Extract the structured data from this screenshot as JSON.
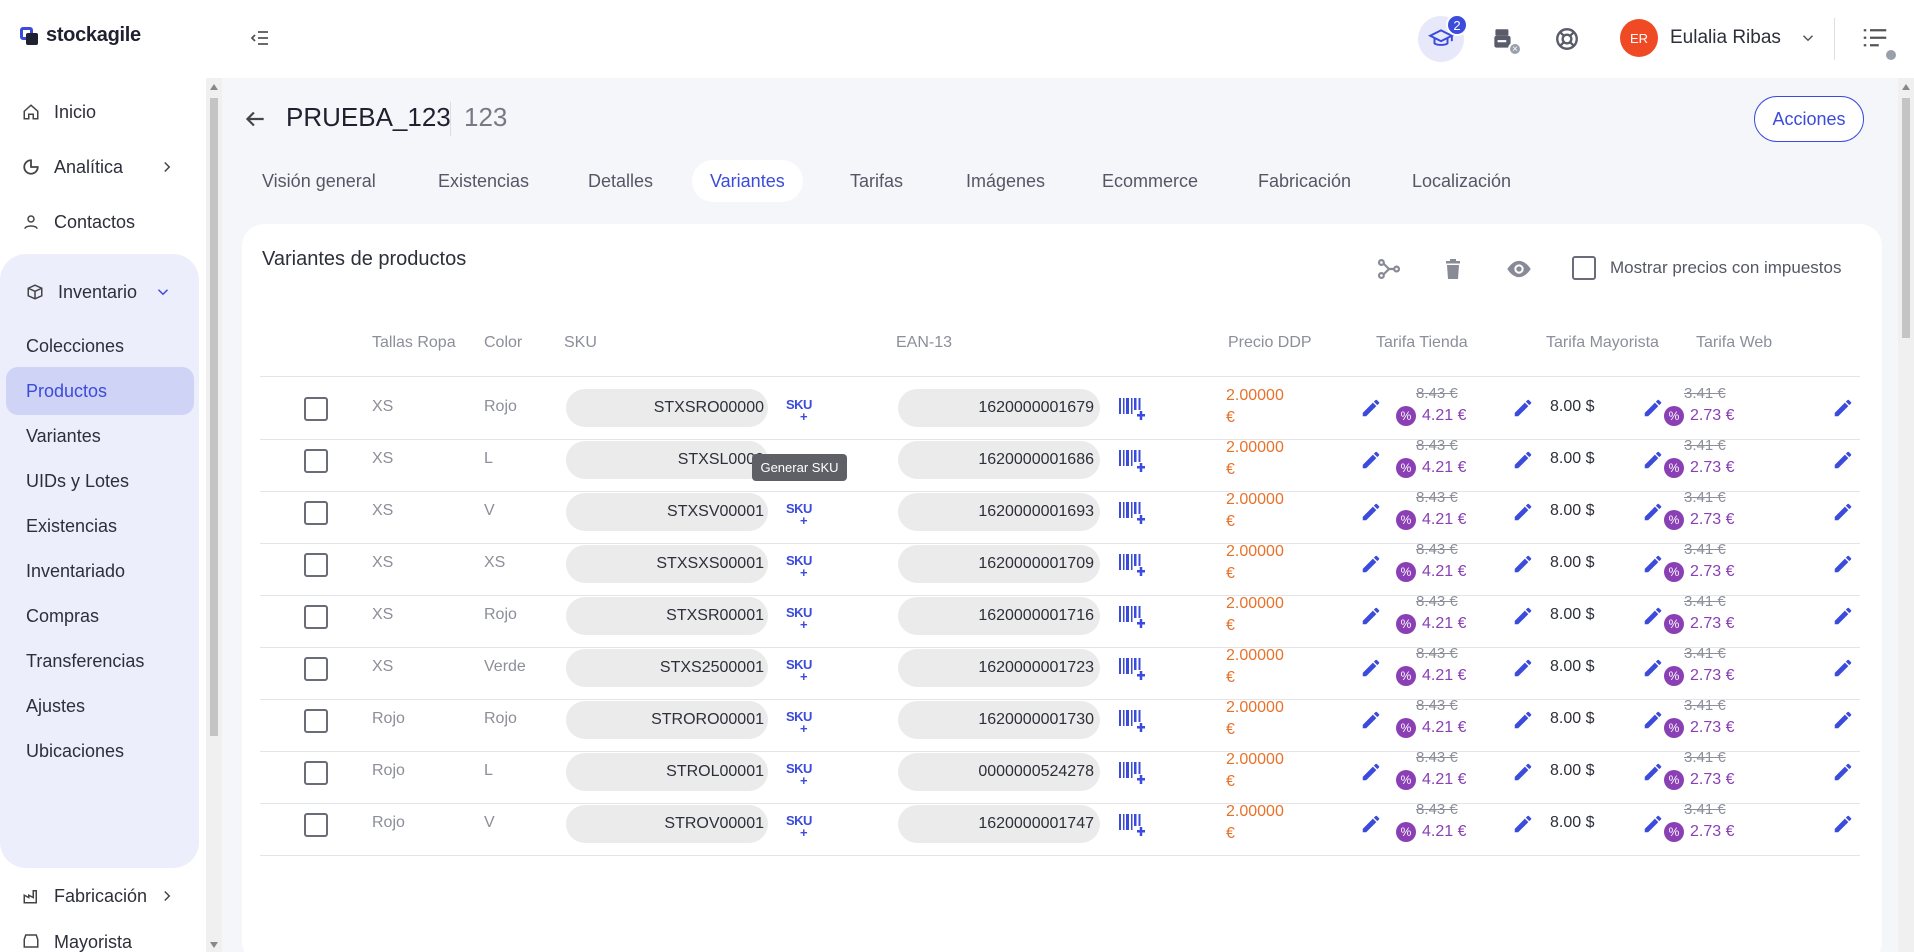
{
  "app": {
    "brand": "stockagile",
    "notifications_count": "2",
    "user_initials": "ER",
    "user_name": "Eulalia Ribas",
    "printer_status": "×"
  },
  "colors": {
    "accent": "#3b4bdb",
    "price": "#e8722a",
    "discount": "#8a3fb5",
    "avatar": "#ef4a23"
  },
  "sidebar": {
    "items": [
      {
        "label": "Inicio",
        "icon": "home-icon"
      },
      {
        "label": "Analítica",
        "icon": "analytics-icon"
      },
      {
        "label": "Contactos",
        "icon": "user-icon"
      },
      {
        "label": "Inventario",
        "icon": "box-icon"
      }
    ],
    "inventory_sub": [
      "Colecciones",
      "Productos",
      "Variantes",
      "UIDs y Lotes",
      "Existencias",
      "Inventariado",
      "Compras",
      "Transferencias",
      "Ajustes",
      "Ubicaciones"
    ],
    "active_sub": "Productos",
    "bottom_items": [
      {
        "label": "Fabricación",
        "icon": "factory-icon"
      },
      {
        "label": "Mayorista",
        "icon": "store-icon"
      }
    ]
  },
  "header": {
    "title": "PRUEBA_123",
    "code": "123",
    "actions_label": "Acciones"
  },
  "tabs": [
    "Visión general",
    "Existencias",
    "Detalles",
    "Variantes",
    "Tarifas",
    "Imágenes",
    "Ecommerce",
    "Fabricación",
    "Localización"
  ],
  "active_tab": "Variantes",
  "variants": {
    "title": "Variantes de productos",
    "tax_toggle_label": "Mostrar precios con impuestos",
    "columns": [
      "Tallas Ropa",
      "Color",
      "SKU",
      "EAN-13",
      "Precio DDP",
      "Tarifa Tienda",
      "Tarifa Mayorista",
      "Tarifa Web"
    ],
    "sku_generate_label": "SKU",
    "tooltip": "Generar SKU",
    "rows": [
      {
        "talla": "XS",
        "color": "Rojo",
        "sku": "STXSRO00000",
        "ean": "1620000001679",
        "price_a": "2.00000",
        "price_b": "€",
        "tienda_old": "8.43 €",
        "tienda_new": "4.21 €",
        "mayorista": "8.00 $",
        "web_old": "3.41 €",
        "web_new": "2.73 €"
      },
      {
        "talla": "XS",
        "color": "L",
        "sku": "STXSL0000",
        "ean": "1620000001686",
        "price_a": "2.00000",
        "price_b": "€",
        "tienda_old": "8.43 €",
        "tienda_new": "4.21 €",
        "mayorista": "8.00 $",
        "web_old": "3.41 €",
        "web_new": "2.73 €"
      },
      {
        "talla": "XS",
        "color": "V",
        "sku": "STXSV00001",
        "ean": "1620000001693",
        "price_a": "2.00000",
        "price_b": "€",
        "tienda_old": "8.43 €",
        "tienda_new": "4.21 €",
        "mayorista": "8.00 $",
        "web_old": "3.41 €",
        "web_new": "2.73 €"
      },
      {
        "talla": "XS",
        "color": "XS",
        "sku": "STXSXS00001",
        "ean": "1620000001709",
        "price_a": "2.00000",
        "price_b": "€",
        "tienda_old": "8.43 €",
        "tienda_new": "4.21 €",
        "mayorista": "8.00 $",
        "web_old": "3.41 €",
        "web_new": "2.73 €"
      },
      {
        "talla": "XS",
        "color": "Rojo",
        "sku": "STXSR00001",
        "ean": "1620000001716",
        "price_a": "2.00000",
        "price_b": "€",
        "tienda_old": "8.43 €",
        "tienda_new": "4.21 €",
        "mayorista": "8.00 $",
        "web_old": "3.41 €",
        "web_new": "2.73 €"
      },
      {
        "talla": "XS",
        "color": "Verde",
        "sku": "STXS2500001",
        "ean": "1620000001723",
        "price_a": "2.00000",
        "price_b": "€",
        "tienda_old": "8.43 €",
        "tienda_new": "4.21 €",
        "mayorista": "8.00 $",
        "web_old": "3.41 €",
        "web_new": "2.73 €"
      },
      {
        "talla": "Rojo",
        "color": "Rojo",
        "sku": "STRORO00001",
        "ean": "1620000001730",
        "price_a": "2.00000",
        "price_b": "€",
        "tienda_old": "8.43 €",
        "tienda_new": "4.21 €",
        "mayorista": "8.00 $",
        "web_old": "3.41 €",
        "web_new": "2.73 €"
      },
      {
        "talla": "Rojo",
        "color": "L",
        "sku": "STROL00001",
        "ean": "0000000524278",
        "price_a": "2.00000",
        "price_b": "€",
        "tienda_old": "8.43 €",
        "tienda_new": "4.21 €",
        "mayorista": "8.00 $",
        "web_old": "3.41 €",
        "web_new": "2.73 €"
      },
      {
        "talla": "Rojo",
        "color": "V",
        "sku": "STROV00001",
        "ean": "1620000001747",
        "price_a": "2.00000",
        "price_b": "€",
        "tienda_old": "8.43 €",
        "tienda_new": "4.21 €",
        "mayorista": "8.00 $",
        "web_old": "3.41 €",
        "web_new": "2.73 €"
      }
    ]
  }
}
